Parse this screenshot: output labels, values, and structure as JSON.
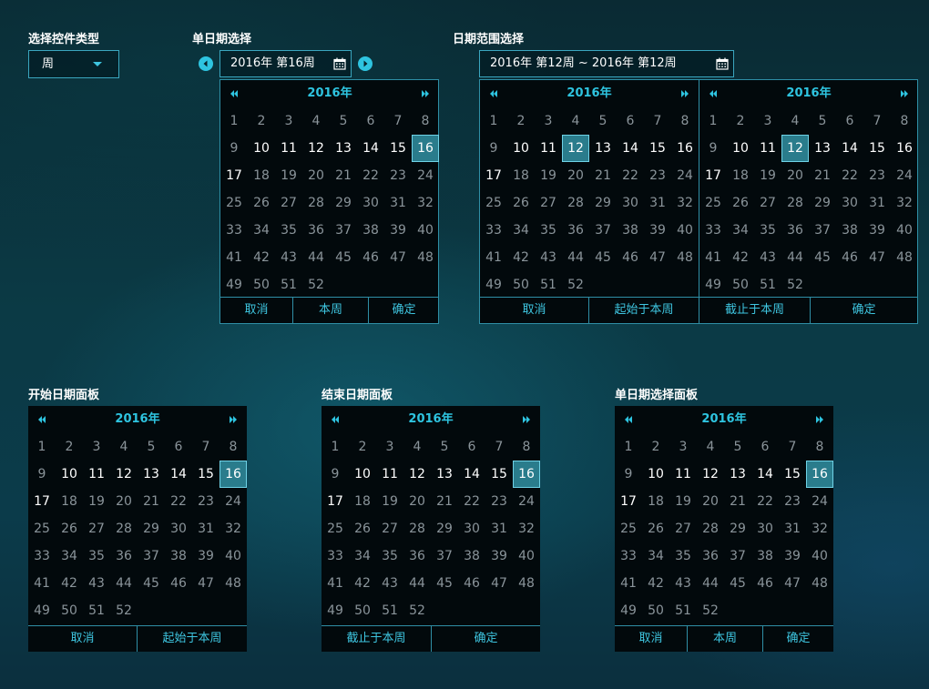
{
  "colors": {
    "accent": "#2ec4e0",
    "selected_bg": "#2a7c8c",
    "border": "#2f8fa6",
    "panel_bg": "#02090c"
  },
  "type_select": {
    "label": "选择控件类型",
    "value": "周",
    "icon": "chevron-down-icon"
  },
  "single_select": {
    "label": "单日期选择",
    "value": "2016年 第16周",
    "prev_icon": "circle-left-arrow-icon",
    "next_icon": "circle-right-arrow-icon",
    "calendar_icon": "calendar-icon"
  },
  "range_select": {
    "label": "日期范围选择",
    "value": "2016年 第12周 ~ 2016年 第12周",
    "calendar_icon": "calendar-icon"
  },
  "calendar": {
    "year": "2016年",
    "weeks": [
      [
        "1",
        "2",
        "3",
        "4",
        "5",
        "6",
        "7",
        "8"
      ],
      [
        "9",
        "10",
        "11",
        "12",
        "13",
        "14",
        "15",
        "16"
      ],
      [
        "17",
        "18",
        "19",
        "20",
        "21",
        "22",
        "23",
        "24"
      ],
      [
        "25",
        "26",
        "27",
        "28",
        "29",
        "30",
        "31",
        "32"
      ],
      [
        "33",
        "34",
        "35",
        "36",
        "37",
        "38",
        "39",
        "40"
      ],
      [
        "41",
        "42",
        "43",
        "44",
        "45",
        "46",
        "47",
        "48"
      ],
      [
        "49",
        "50",
        "51",
        "52"
      ]
    ],
    "current_weeks": [
      "10",
      "11",
      "12",
      "13",
      "14",
      "15",
      "16",
      "17"
    ],
    "prev_icon": "double-left-arrow-icon",
    "next_icon": "double-right-arrow-icon"
  },
  "popup_single": {
    "selected": "16",
    "buttons": [
      "取消",
      "本周",
      "确定"
    ]
  },
  "popup_range": {
    "left_selected": "12",
    "right_selected": "12",
    "buttons": [
      "取消",
      "起始于本周",
      "截止于本周",
      "确定"
    ]
  },
  "panels": [
    {
      "label": "开始日期面板",
      "selected": "16",
      "buttons": [
        "取消",
        "起始于本周"
      ]
    },
    {
      "label": "结束日期面板",
      "selected": "16",
      "buttons": [
        "截止于本周",
        "确定"
      ]
    },
    {
      "label": "单日期选择面板",
      "selected": "16",
      "buttons": [
        "取消",
        "本周",
        "确定"
      ]
    }
  ]
}
